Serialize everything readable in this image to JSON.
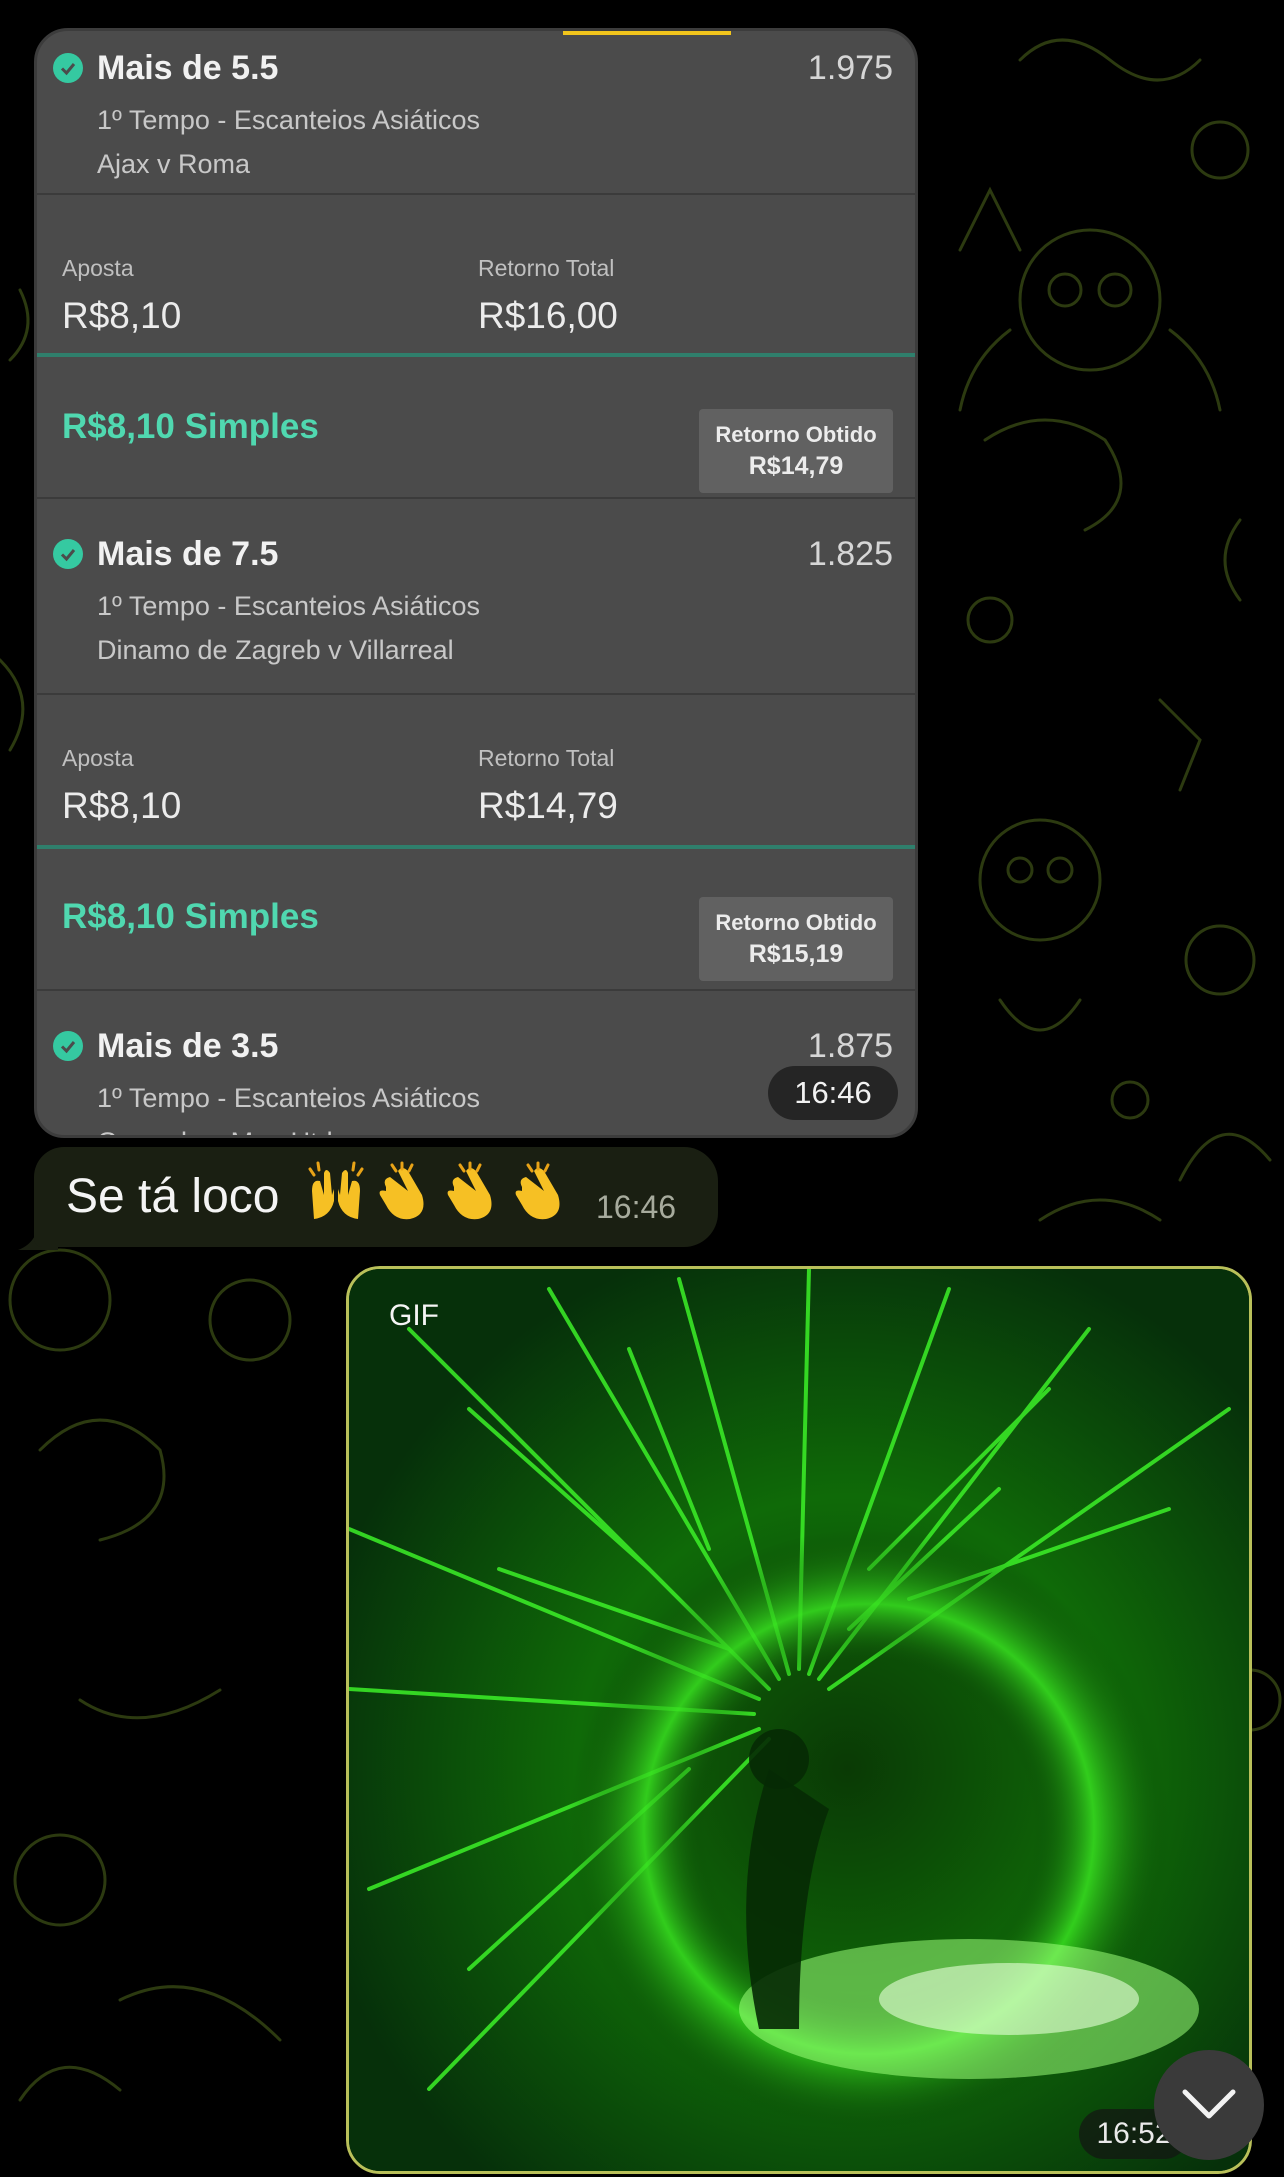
{
  "slip": {
    "selections": [
      {
        "title": "Mais de 5.5",
        "odds": "1.975",
        "market": "1º Tempo - Escanteios Asiáticos",
        "match": "Ajax v Roma"
      },
      {
        "title": "Mais de 7.5",
        "odds": "1.825",
        "market": "1º Tempo - Escanteios Asiáticos",
        "match": "Dinamo de Zagreb v Villarreal"
      },
      {
        "title": "Mais de 3.5",
        "odds": "1.875",
        "market": "1º Tempo - Escanteios Asiáticos",
        "match": "Granada v Man Utd"
      }
    ],
    "stakes": [
      {
        "stake_label": "Aposta",
        "stake_value": "R$8,10",
        "return_label": "Retorno Total",
        "return_value": "R$16,00"
      },
      {
        "stake_label": "Aposta",
        "stake_value": "R$8,10",
        "return_label": "Retorno Total",
        "return_value": "R$14,79"
      }
    ],
    "simples": [
      {
        "title": "R$8,10 Simples",
        "return_label": "Retorno Obtido",
        "return_value": "R$14,79"
      },
      {
        "title": "R$8,10 Simples",
        "return_label": "Retorno Obtido",
        "return_value": "R$15,19"
      }
    ],
    "time": "16:46"
  },
  "message": {
    "text": "Se tá loco",
    "emojis": [
      "raising-hands-emoji",
      "clapping-hands-emoji",
      "clapping-hands-emoji",
      "clapping-hands-emoji"
    ],
    "time": "16:46"
  },
  "gif": {
    "badge": "GIF",
    "time": "16:52"
  },
  "icons": {
    "check": "check-circle-icon",
    "scroll": "chevron-down-icon"
  },
  "colors": {
    "accent_green": "#50d8b0",
    "check_green": "#35c9a1",
    "card_bg": "#4b4b4b",
    "wallpaper_line": "#2e3a12"
  }
}
